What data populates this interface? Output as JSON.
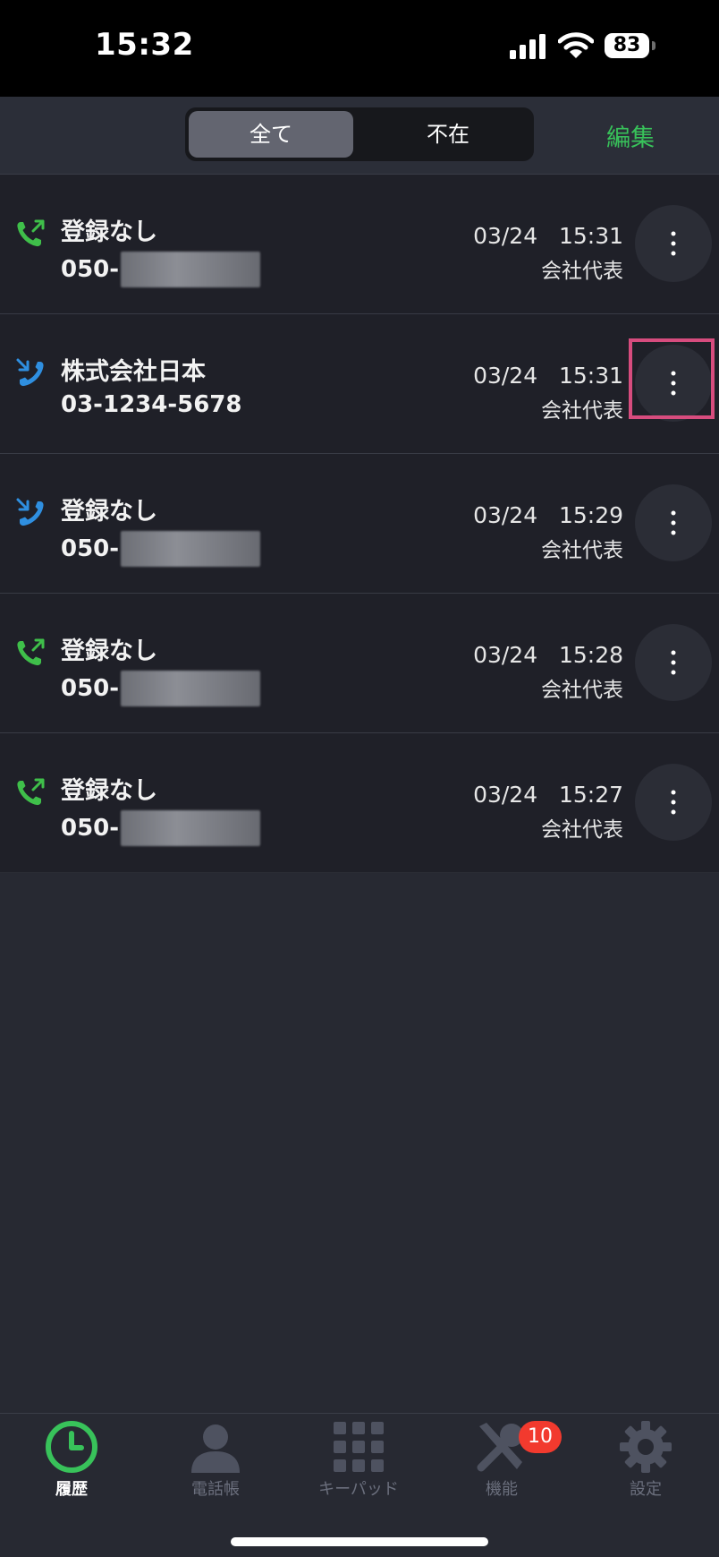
{
  "status_bar": {
    "time": "15:32",
    "battery": "83"
  },
  "header": {
    "segments": [
      {
        "label": "全て"
      },
      {
        "label": "不在"
      }
    ],
    "edit_label": "編集"
  },
  "calls": [
    {
      "direction": "outgoing",
      "name": "登録なし",
      "number_prefix": "050-",
      "date": "03/24",
      "time": "15:31",
      "line": "会社代表"
    },
    {
      "direction": "incoming",
      "name": "株式会社日本",
      "number_prefix": "03-1234-5678",
      "date": "03/24",
      "time": "15:31",
      "line": "会社代表"
    },
    {
      "direction": "incoming",
      "name": "登録なし",
      "number_prefix": "050-",
      "date": "03/24",
      "time": "15:29",
      "line": "会社代表"
    },
    {
      "direction": "outgoing",
      "name": "登録なし",
      "number_prefix": "050-",
      "date": "03/24",
      "time": "15:28",
      "line": "会社代表"
    },
    {
      "direction": "outgoing",
      "name": "登録なし",
      "number_prefix": "050-",
      "date": "03/24",
      "time": "15:27",
      "line": "会社代表"
    }
  ],
  "tabs": [
    {
      "label": "履歴",
      "icon": "clock-icon",
      "active": true
    },
    {
      "label": "電話帳",
      "icon": "person-icon",
      "active": false
    },
    {
      "label": "キーパッド",
      "icon": "keypad-icon",
      "active": false
    },
    {
      "label": "機能",
      "icon": "tools-icon",
      "active": false,
      "badge": "10"
    },
    {
      "label": "設定",
      "icon": "gear-icon",
      "active": false
    }
  ],
  "colors": {
    "accent_green": "#38c25a",
    "incoming_blue": "#2f8fe0",
    "highlight": "#d74c7e",
    "badge_red": "#f23a2e"
  }
}
